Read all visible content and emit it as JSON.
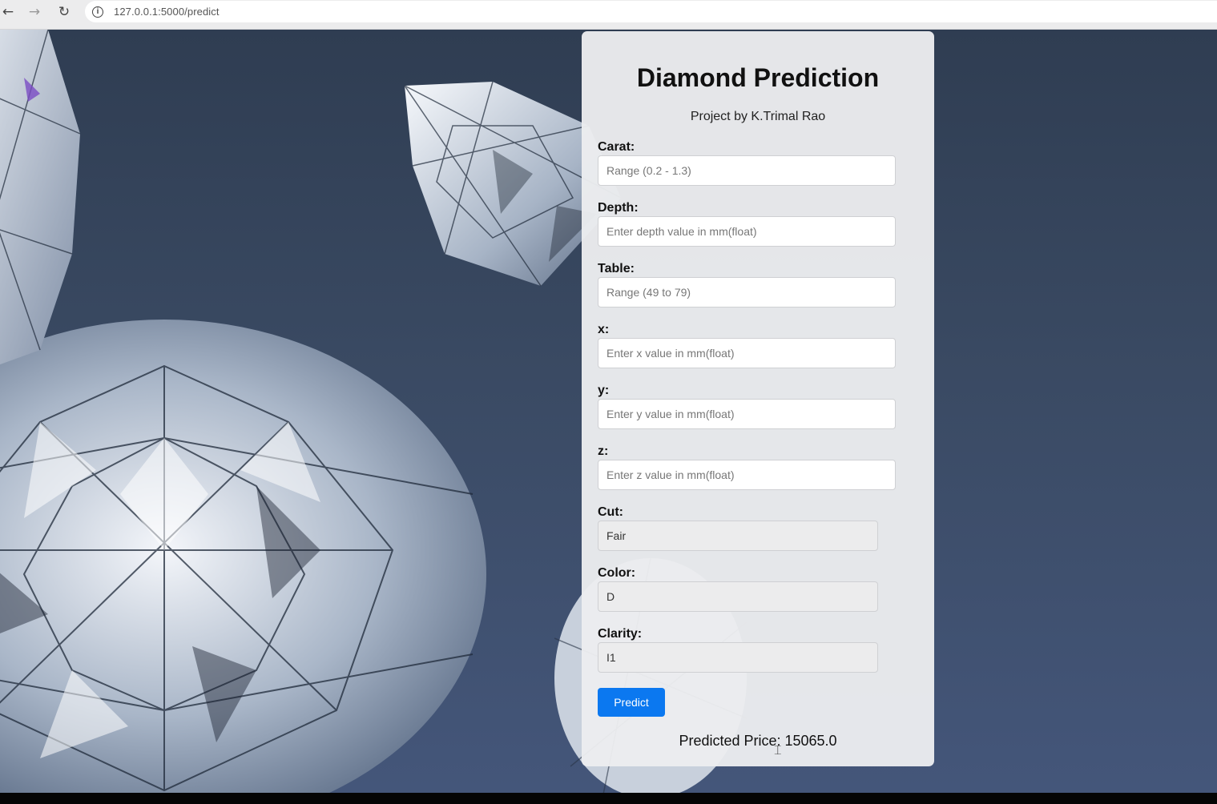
{
  "browser": {
    "url": "127.0.0.1:5000/predict",
    "back_icon": "arrow-left-icon",
    "forward_icon": "arrow-right-icon",
    "reload_icon": "reload-icon",
    "info_icon": "info-icon"
  },
  "form": {
    "title": "Diamond Prediction",
    "subtitle": "Project by K.Trimal Rao",
    "fields": {
      "carat": {
        "label": "Carat:",
        "placeholder": "Range (0.2 - 1.3)",
        "value": ""
      },
      "depth": {
        "label": "Depth:",
        "placeholder": "Enter depth value in mm(float)",
        "value": ""
      },
      "table": {
        "label": "Table:",
        "placeholder": "Range (49 to 79)",
        "value": ""
      },
      "x": {
        "label": "x:",
        "placeholder": "Enter x value in mm(float)",
        "value": ""
      },
      "y": {
        "label": "y:",
        "placeholder": "Enter y value in mm(float)",
        "value": ""
      },
      "z": {
        "label": "z:",
        "placeholder": "Enter z value in mm(float)",
        "value": ""
      }
    },
    "selects": {
      "cut": {
        "label": "Cut:",
        "selected": "Fair"
      },
      "color": {
        "label": "Color:",
        "selected": "D"
      },
      "clarity": {
        "label": "Clarity:",
        "selected": "I1"
      }
    },
    "predict_label": "Predict",
    "result": "Predicted Price: 15065.0"
  },
  "colors": {
    "background": "#3a4a63",
    "panel": "#ecedef",
    "button": "#0b78f0"
  }
}
